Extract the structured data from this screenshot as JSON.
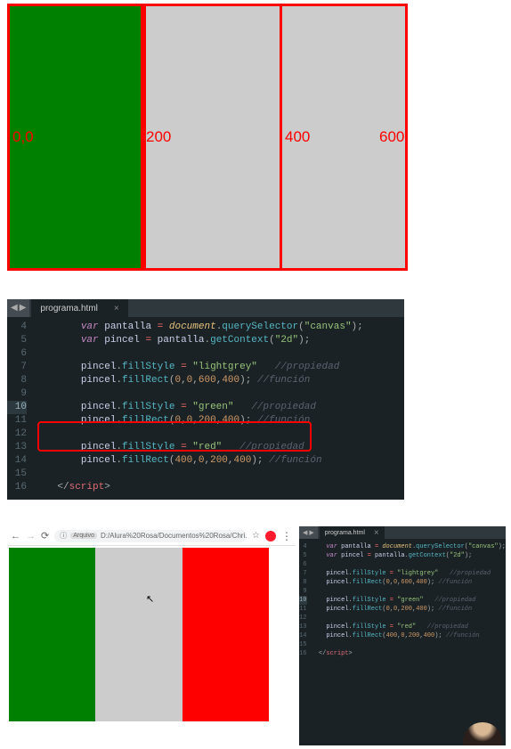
{
  "diagram": {
    "label_00": "0,0",
    "label_200": "200",
    "label_400": "400",
    "label_600": "600"
  },
  "editor_main": {
    "tab_name": "programa.html",
    "lines": {
      "4": "        var pantalla = document.querySelector(\"canvas\");",
      "5": "        var pincel = pantalla.getContext(\"2d\");",
      "6": "",
      "7": "        pincel.fillStyle = \"lightgrey\"   //propiedad",
      "8": "        pincel.fillRect(0,0,600,400); //función",
      "9": "",
      "10": "        pincel.fillStyle = \"green\"   //propiedad",
      "11": "        pincel.fillRect(0,0,200,400); //función",
      "12": "",
      "13": "        pincel.fillStyle = \"red\"   //propiedad",
      "14": "        pincel.fillRect(400,0,200,400); //función",
      "15": "",
      "16": "    </script_>"
    }
  },
  "browser": {
    "url_chip": "Arquivo",
    "url_path": "D:/Alura%20Rosa/Documentos%20Rosa/Chri..."
  },
  "editor_small": {
    "tab_name": "programa.html"
  }
}
